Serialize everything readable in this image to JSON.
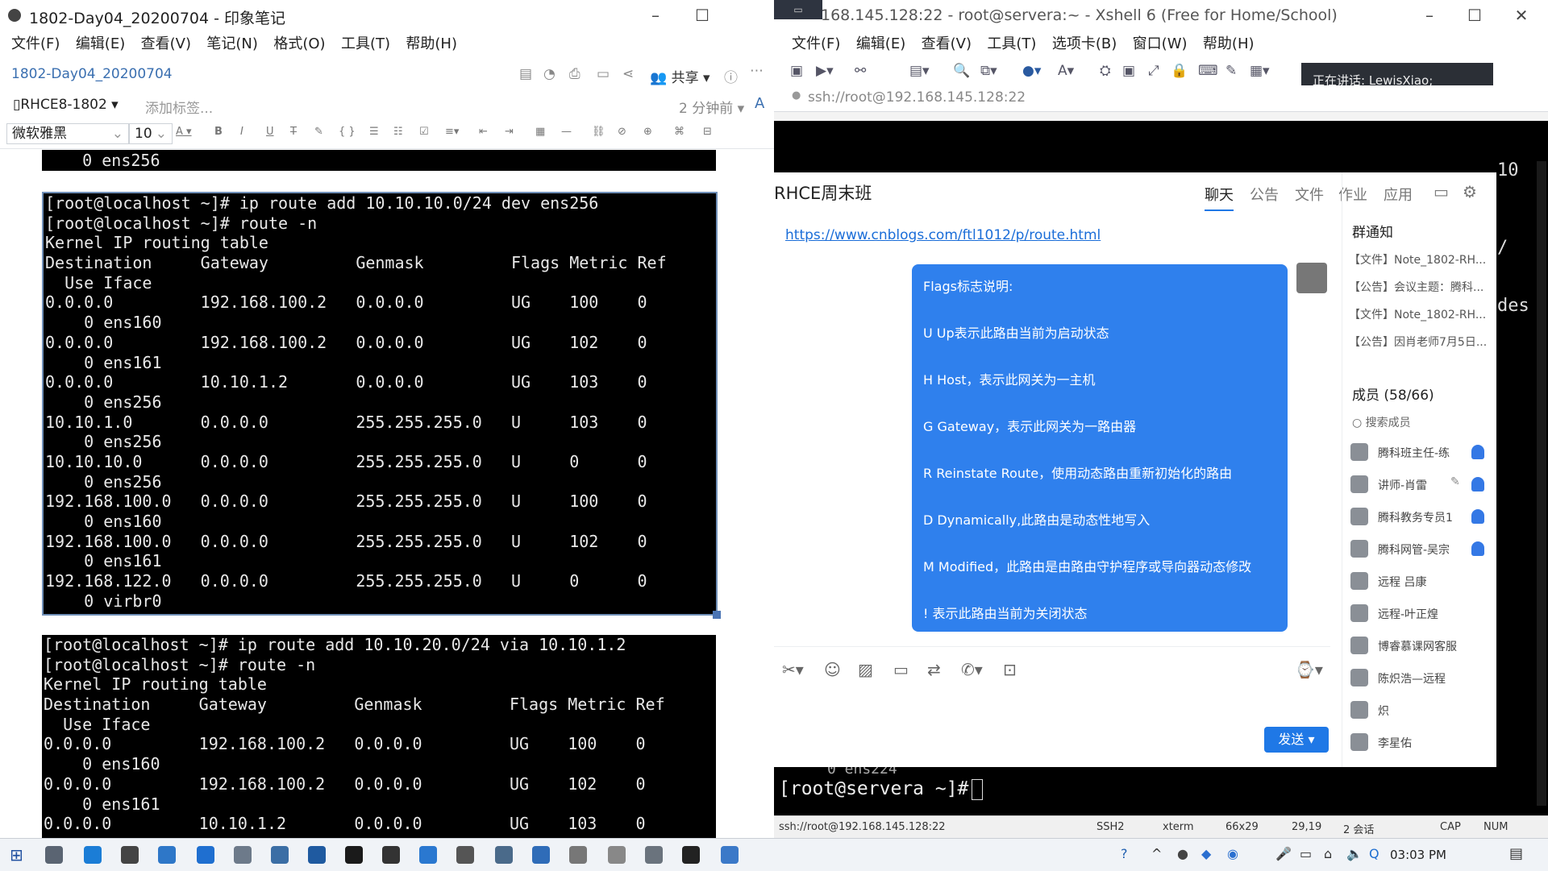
{
  "evernote": {
    "title": "1802-Day04_20200704 - 印象笔记",
    "menu": [
      "文件(F)",
      "编辑(E)",
      "查看(V)",
      "笔记(N)",
      "格式(O)",
      "工具(T)",
      "帮助(H)"
    ],
    "note_title": "1802-Day04_20200704",
    "share_label": "共享",
    "notebook": "RHCE8-1802",
    "add_tag": "添加标签...",
    "edited_ago": "2 分钟前",
    "font_family": "微软雅黑",
    "font_size": "10",
    "format_buttons": [
      "B",
      "I",
      "U",
      "T"
    ],
    "terminal_top": "    0 ens256",
    "terminal_a": [
      "[root@localhost ~]# ip route add 10.10.10.0/24 dev ens256",
      "[root@localhost ~]# route -n",
      "Kernel IP routing table",
      "Destination     Gateway         Genmask         Flags Metric Ref",
      "  Use Iface",
      "0.0.0.0         192.168.100.2   0.0.0.0         UG    100    0",
      "    0 ens160",
      "0.0.0.0         192.168.100.2   0.0.0.0         UG    102    0",
      "    0 ens161",
      "0.0.0.0         10.10.1.2       0.0.0.0         UG    103    0",
      "    0 ens256",
      "10.10.1.0       0.0.0.0         255.255.255.0   U     103    0",
      "    0 ens256",
      "10.10.10.0      0.0.0.0         255.255.255.0   U     0      0",
      "    0 ens256",
      "192.168.100.0   0.0.0.0         255.255.255.0   U     100    0",
      "    0 ens160",
      "192.168.100.0   0.0.0.0         255.255.255.0   U     102    0",
      "    0 ens161",
      "192.168.122.0   0.0.0.0         255.255.255.0   U     0      0",
      "    0 virbr0"
    ],
    "terminal_b": [
      "[root@localhost ~]# ip route add 10.10.20.0/24 via 10.10.1.2",
      "[root@localhost ~]# route -n",
      "Kernel IP routing table",
      "Destination     Gateway         Genmask         Flags Metric Ref",
      "  Use Iface",
      "0.0.0.0         192.168.100.2   0.0.0.0         UG    100    0",
      "    0 ens160",
      "0.0.0.0         192.168.100.2   0.0.0.0         UG    102    0",
      "    0 ens161",
      "0.0.0.0         10.10.1.2       0.0.0.0         UG    103    0"
    ]
  },
  "xshell": {
    "title": "168.145.128:22 - root@servera:~ - Xshell 6 (Free for Home/School)",
    "menu": [
      "文件(F)",
      "编辑(E)",
      "查看(V)",
      "工具(T)",
      "选项卡(B)",
      "窗口(W)",
      "帮助(H)"
    ],
    "address": "ssh://root@192.168.145.128:22",
    "speaking": "正在讲话: LewisXiao;",
    "terminal_right": "10\n\n\n\n/\n\n\ndes",
    "terminal_tail": "0 ens224",
    "prompt": "[root@servera ~]#",
    "status": {
      "connection": "ssh://root@192.168.145.128:22",
      "protocol": "SSH2",
      "term": "xterm",
      "size": "66x29",
      "cursor": "29,19",
      "sessions": "2 会话",
      "cap": "CAP",
      "num": "NUM"
    }
  },
  "chat": {
    "group_name": "RHCE周末班",
    "tabs": [
      "聊天",
      "公告",
      "文件",
      "作业",
      "应用"
    ],
    "link": "https://www.cnblogs.com/ftl1012/p/route.html",
    "bubble_lines": [
      "Flags标志说明:",
      "U Up表示此路由当前为启动状态",
      "H Host，表示此网关为一主机",
      "G Gateway，表示此网关为一路由器",
      "R Reinstate Route，使用动态路由重新初始化的路由",
      "D Dynamically,此路由是动态性地写入",
      "M Modified，此路由是由路由守护程序或导向器动态修改",
      "! 表示此路由当前为关闭状态"
    ],
    "send_label": "发送",
    "notice_title": "群通知",
    "notices": [
      "【文件】Note_1802-RH...",
      "【公告】会议主题：腾科...",
      "【文件】Note_1802-RH...",
      "【公告】因肖老师7月5日..."
    ],
    "members_title": "成员 (58/66)",
    "search_members": "搜索成员",
    "members": [
      "腾科班主任-练",
      "讲师-肖雷",
      "腾科教务专员1",
      "腾科网管-吴宗",
      "远程 吕康",
      "远程-叶正煌",
      "博睿慕课网客服",
      "陈炽浩—远程",
      "炽",
      "李星佑"
    ]
  },
  "taskbar": {
    "time": "03:03 PM"
  }
}
